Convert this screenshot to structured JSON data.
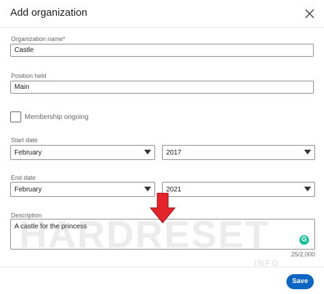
{
  "dialog": {
    "title": "Add organization"
  },
  "fields": {
    "org_name_label": "Organization name*",
    "org_name_value": "Castle",
    "position_label": "Position held",
    "position_value": "Main",
    "membership_label": "Membership ongoing",
    "membership_checked": false,
    "start_label": "Start date",
    "start_month": "February",
    "start_year": "2017",
    "end_label": "End date",
    "end_month": "February",
    "end_year": "2021",
    "description_label": "Description",
    "description_value": "A castle for the princess",
    "counter": "25/2,000"
  },
  "footer": {
    "save_label": "Save"
  },
  "watermark": {
    "main": "HARDRESET",
    "sub": "INFO"
  },
  "colors": {
    "accent": "#0a66c2",
    "arrow": "#e3242b",
    "grammarly": "#15c39a"
  },
  "icons": {
    "close": "close-icon",
    "caret": "chevron-down-icon",
    "grammarly": "grammarly-icon",
    "arrow": "arrow-down-icon"
  }
}
